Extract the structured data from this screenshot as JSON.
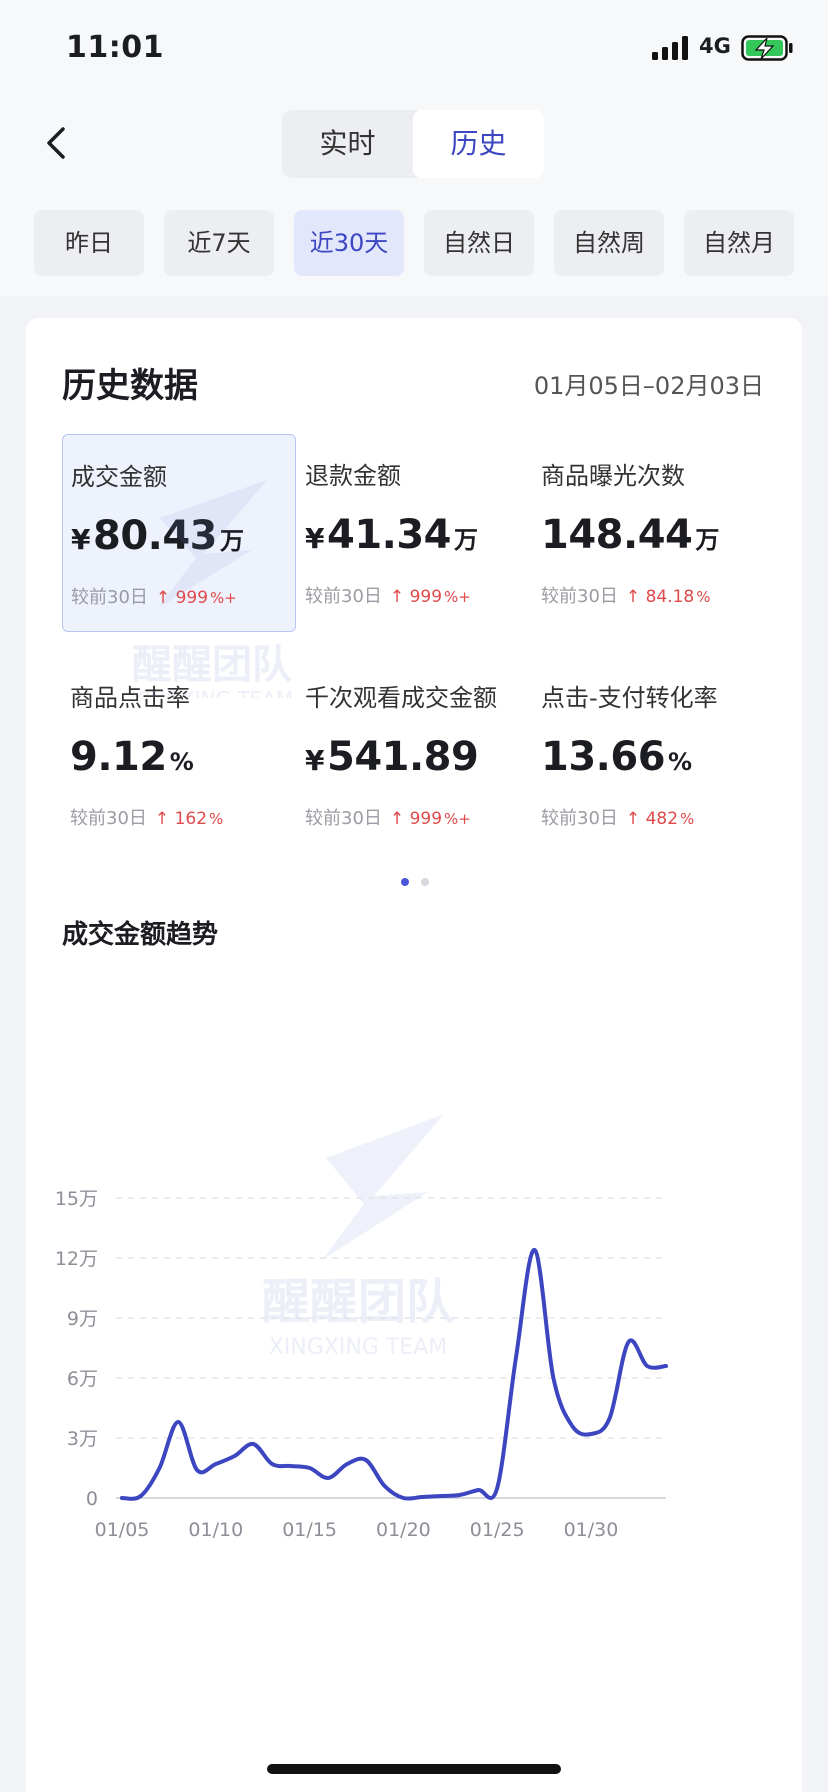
{
  "status_bar": {
    "time": "11:01",
    "network": "4G"
  },
  "segment": {
    "tabs": [
      "实时",
      "历史"
    ],
    "active": 1
  },
  "ranges": {
    "items": [
      "昨日",
      "近7天",
      "近30天",
      "自然日",
      "自然周",
      "自然月"
    ],
    "active": 2
  },
  "history": {
    "title": "历史数据",
    "date_range": "01月05日–02月03日"
  },
  "metrics": [
    {
      "label": "成交金额",
      "currency": "¥",
      "value": "80.43",
      "unit": "万",
      "compare": "较前30日",
      "change": "999",
      "change_unit": "%+"
    },
    {
      "label": "退款金额",
      "currency": "¥",
      "value": "41.34",
      "unit": "万",
      "compare": "较前30日",
      "change": "999",
      "change_unit": "%+"
    },
    {
      "label": "商品曝光次数",
      "currency": "",
      "value": "148.44",
      "unit": "万",
      "compare": "较前30日",
      "change": "84.18",
      "change_unit": "%"
    },
    {
      "label": "商品点击率",
      "currency": "",
      "value": "9.12",
      "unit": "%",
      "compare": "较前30日",
      "change": "162",
      "change_unit": "%"
    },
    {
      "label": "千次观看成交金额",
      "currency": "¥",
      "value": "541.89",
      "unit": "",
      "compare": "较前30日",
      "change": "999",
      "change_unit": "%+"
    },
    {
      "label": "点击-支付转化率",
      "currency": "",
      "value": "13.66",
      "unit": "%",
      "compare": "较前30日",
      "change": "482",
      "change_unit": "%"
    }
  ],
  "pager": {
    "count": 2,
    "active": 0
  },
  "trend": {
    "title": "成交金额趋势"
  },
  "watermark": {
    "cn": "醒醒团队",
    "en": "XINGXING TEAM"
  },
  "colors": {
    "accent": "#3c47c1",
    "line": "#3c46c0",
    "up": "#e04a4a",
    "grid": "#dfe1e6"
  },
  "chart_data": {
    "type": "line",
    "title": "成交金额趋势",
    "xlabel": "",
    "ylabel": "",
    "y_ticks": [
      "0",
      "3万",
      "6万",
      "9万",
      "12万",
      "15万"
    ],
    "ylim": [
      0,
      150000
    ],
    "x_ticks": [
      "01/05",
      "01/10",
      "01/15",
      "01/20",
      "01/25",
      "01/30"
    ],
    "grid": true,
    "legend": "none",
    "series": [
      {
        "x": [
          "01/05",
          "01/06",
          "01/07",
          "01/08",
          "01/09",
          "01/10",
          "01/11",
          "01/12",
          "01/13",
          "01/14",
          "01/15",
          "01/16",
          "01/17",
          "01/18",
          "01/19",
          "01/20",
          "01/21",
          "01/22",
          "01/23",
          "01/24",
          "01/25",
          "01/26",
          "01/27",
          "01/28",
          "01/29",
          "01/30",
          "01/31",
          "02/01",
          "02/02",
          "02/03"
        ],
        "values": [
          0,
          1000,
          15000,
          38000,
          14000,
          17000,
          21000,
          27000,
          17000,
          16000,
          15000,
          10000,
          17000,
          19000,
          6000,
          0,
          500,
          1000,
          1500,
          4000,
          5000,
          70000,
          124000,
          60000,
          36000,
          32000,
          40000,
          78000,
          66000,
          66000
        ]
      }
    ]
  }
}
